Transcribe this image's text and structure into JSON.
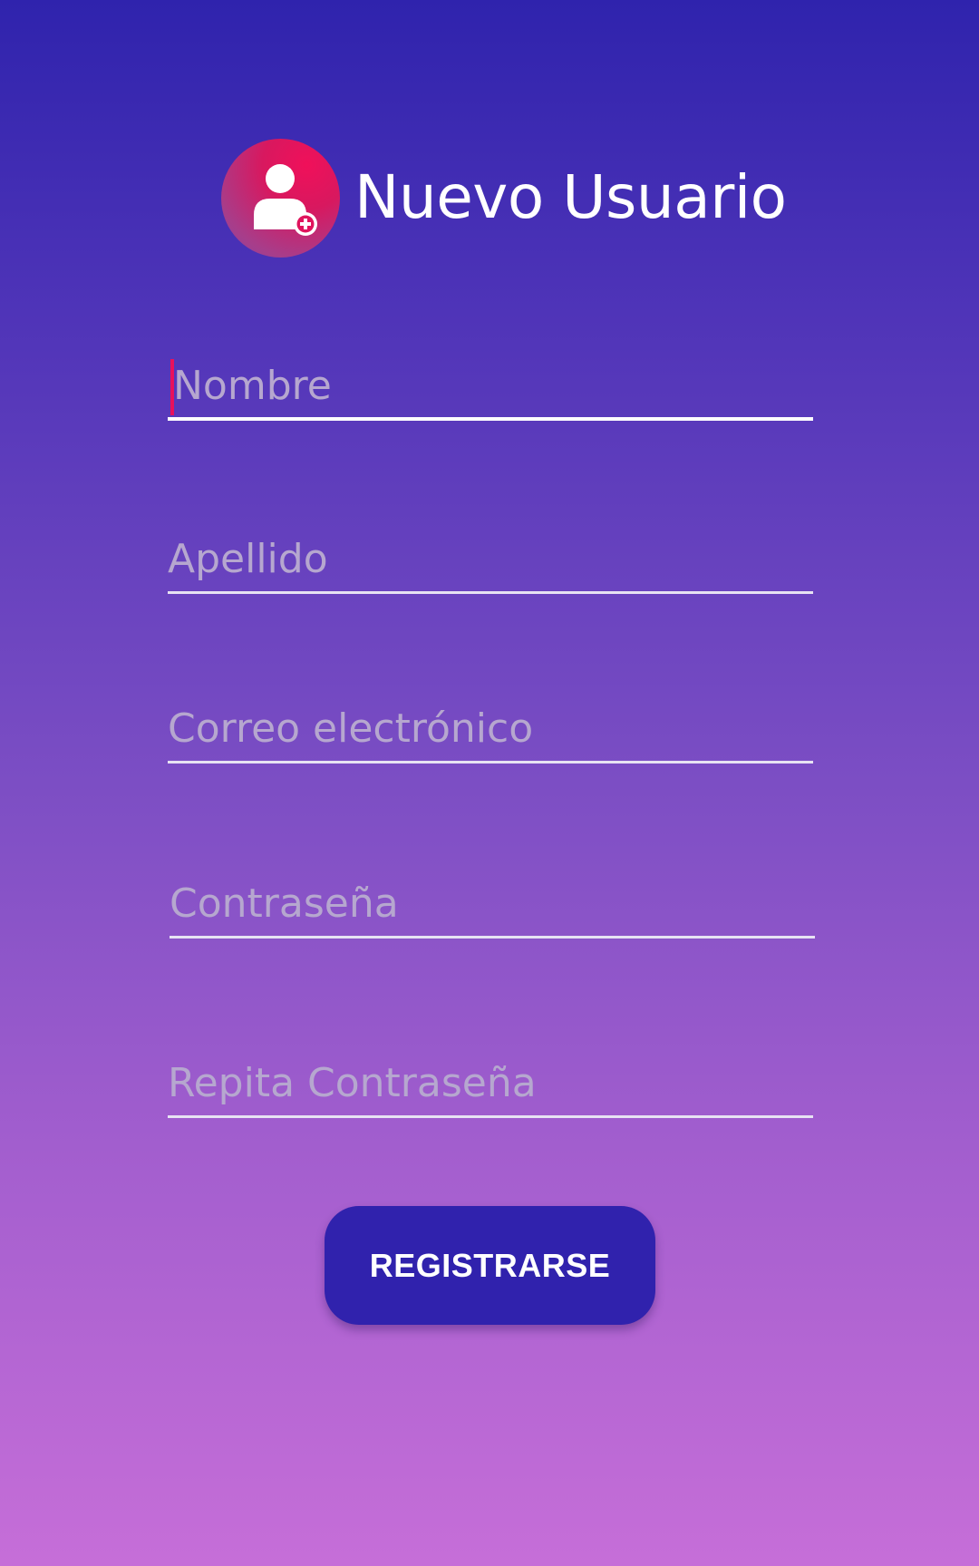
{
  "header": {
    "title": "Nuevo Usuario",
    "icon": "add-user-icon"
  },
  "form": {
    "fields": [
      {
        "placeholder": "Nombre",
        "value": "",
        "focused": true
      },
      {
        "placeholder": "Apellido",
        "value": ""
      },
      {
        "placeholder": "Correo electrónico",
        "value": ""
      },
      {
        "placeholder": "Contraseña",
        "value": ""
      },
      {
        "placeholder": "Repita Contraseña",
        "value": ""
      }
    ],
    "submit_label": "REGISTRARSE"
  },
  "colors": {
    "gradient_top": "#2f23ad",
    "gradient_bottom": "#c66ed8",
    "button": "#3022ad",
    "accent": "#e8115c",
    "placeholder": "#b6a7cf"
  }
}
